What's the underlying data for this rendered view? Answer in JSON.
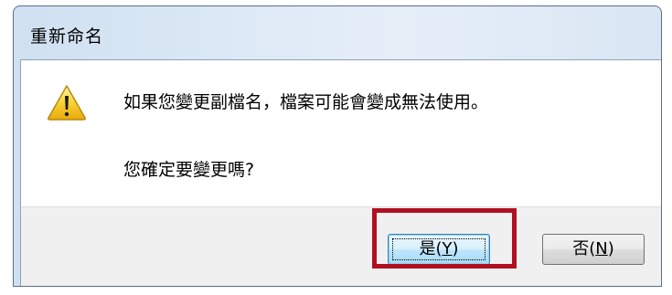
{
  "dialog": {
    "title": "重新命名",
    "message": "如果您變更副檔名，檔案可能會變成無法使用。",
    "question": "您確定要變更嗎?",
    "icon": "warning-icon"
  },
  "buttons": {
    "yes": {
      "label": "是",
      "mnemonic_open": "(",
      "mnemonic": "Y",
      "mnemonic_close": ")"
    },
    "no": {
      "label": "否",
      "mnemonic_open": "(",
      "mnemonic": "N",
      "mnemonic_close": ")"
    }
  },
  "colors": {
    "highlight_border": "#b01020",
    "title_bar": "#dde9f6",
    "footer": "#f0f0f0"
  }
}
